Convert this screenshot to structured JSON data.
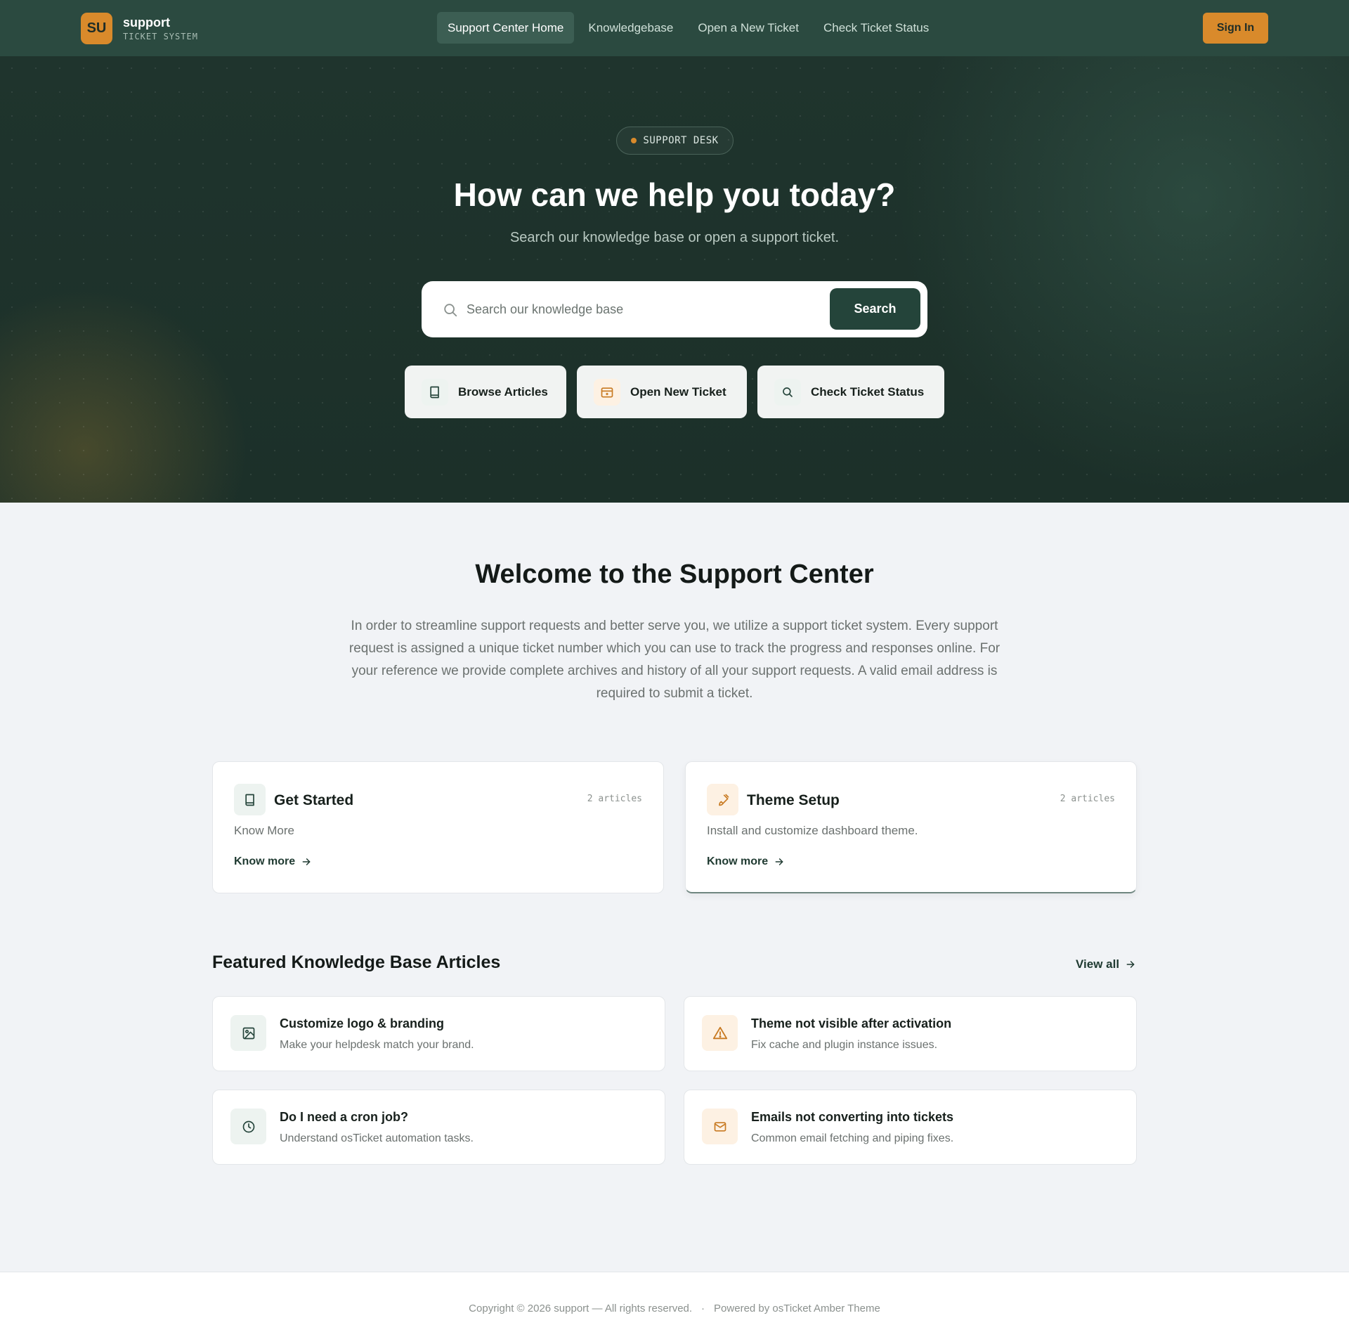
{
  "header": {
    "logo_initials": "SU",
    "brand_name": "support",
    "brand_sub": "TICKET SYSTEM",
    "nav": [
      {
        "label": "Support Center Home",
        "active": true
      },
      {
        "label": "Knowledgebase"
      },
      {
        "label": "Open a New Ticket"
      },
      {
        "label": "Check Ticket Status"
      }
    ],
    "signin_label": "Sign In"
  },
  "hero": {
    "badge": "SUPPORT DESK",
    "title": "How can we help you today?",
    "subtitle": "Search our knowledge base or open a support ticket.",
    "search_placeholder": "Search our knowledge base",
    "search_button": "Search",
    "quick_links": [
      {
        "label": "Browse Articles",
        "icon": "book-icon"
      },
      {
        "label": "Open New Ticket",
        "icon": "ticket-icon"
      },
      {
        "label": "Check Ticket Status",
        "icon": "search-icon"
      }
    ]
  },
  "welcome": {
    "title": "Welcome to the Support Center",
    "text": "In order to streamline support requests and better serve you, we utilize a support ticket system. Every support request is assigned a unique ticket number which you can use to track the progress and responses online. For your reference we provide complete archives and history of all your support requests. A valid email address is required to submit a ticket."
  },
  "categories": [
    {
      "title": "Get Started",
      "count": "2 articles",
      "desc": "Know More",
      "link": "Know more",
      "icon": "book-icon"
    },
    {
      "title": "Theme Setup",
      "count": "2 articles",
      "desc": "Install and customize dashboard theme.",
      "link": "Know more",
      "icon": "brush-icon"
    }
  ],
  "featured": {
    "title": "Featured Knowledge Base Articles",
    "view_all": "View all",
    "articles": [
      {
        "title": "Customize logo & branding",
        "desc": "Make your helpdesk match your brand.",
        "icon": "image-icon"
      },
      {
        "title": "Theme not visible after activation",
        "desc": "Fix cache and plugin instance issues.",
        "icon": "warning-icon"
      },
      {
        "title": "Do I need a cron job?",
        "desc": "Understand osTicket automation tasks.",
        "icon": "clock-icon"
      },
      {
        "title": "Emails not converting into tickets",
        "desc": "Common email fetching and piping fixes.",
        "icon": "mail-icon"
      }
    ]
  },
  "footer": {
    "copyright": "Copyright © 2026 support — All rights reserved.",
    "separator": "·",
    "powered": "Powered by osTicket Amber Theme"
  },
  "colors": {
    "header_bg": "#2b4a40",
    "hero_bg": "#1f342d",
    "accent": "#d98a2b",
    "primary_button": "#24443a",
    "page_bg": "#f1f3f6"
  }
}
